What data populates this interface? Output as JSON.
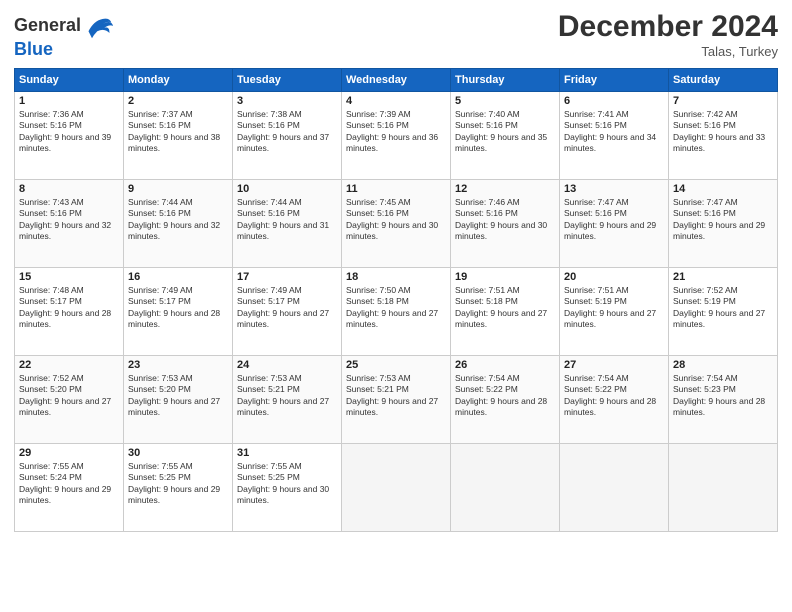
{
  "logo": {
    "text_general": "General",
    "text_blue": "Blue"
  },
  "header": {
    "month": "December 2024",
    "location": "Talas, Turkey"
  },
  "days_of_week": [
    "Sunday",
    "Monday",
    "Tuesday",
    "Wednesday",
    "Thursday",
    "Friday",
    "Saturday"
  ],
  "weeks": [
    [
      {
        "day": "1",
        "info": "Sunrise: 7:36 AM\nSunset: 5:16 PM\nDaylight: 9 hours and 39 minutes."
      },
      {
        "day": "2",
        "info": "Sunrise: 7:37 AM\nSunset: 5:16 PM\nDaylight: 9 hours and 38 minutes."
      },
      {
        "day": "3",
        "info": "Sunrise: 7:38 AM\nSunset: 5:16 PM\nDaylight: 9 hours and 37 minutes."
      },
      {
        "day": "4",
        "info": "Sunrise: 7:39 AM\nSunset: 5:16 PM\nDaylight: 9 hours and 36 minutes."
      },
      {
        "day": "5",
        "info": "Sunrise: 7:40 AM\nSunset: 5:16 PM\nDaylight: 9 hours and 35 minutes."
      },
      {
        "day": "6",
        "info": "Sunrise: 7:41 AM\nSunset: 5:16 PM\nDaylight: 9 hours and 34 minutes."
      },
      {
        "day": "7",
        "info": "Sunrise: 7:42 AM\nSunset: 5:16 PM\nDaylight: 9 hours and 33 minutes."
      }
    ],
    [
      {
        "day": "8",
        "info": "Sunrise: 7:43 AM\nSunset: 5:16 PM\nDaylight: 9 hours and 32 minutes."
      },
      {
        "day": "9",
        "info": "Sunrise: 7:44 AM\nSunset: 5:16 PM\nDaylight: 9 hours and 32 minutes."
      },
      {
        "day": "10",
        "info": "Sunrise: 7:44 AM\nSunset: 5:16 PM\nDaylight: 9 hours and 31 minutes."
      },
      {
        "day": "11",
        "info": "Sunrise: 7:45 AM\nSunset: 5:16 PM\nDaylight: 9 hours and 30 minutes."
      },
      {
        "day": "12",
        "info": "Sunrise: 7:46 AM\nSunset: 5:16 PM\nDaylight: 9 hours and 30 minutes."
      },
      {
        "day": "13",
        "info": "Sunrise: 7:47 AM\nSunset: 5:16 PM\nDaylight: 9 hours and 29 minutes."
      },
      {
        "day": "14",
        "info": "Sunrise: 7:47 AM\nSunset: 5:16 PM\nDaylight: 9 hours and 29 minutes."
      }
    ],
    [
      {
        "day": "15",
        "info": "Sunrise: 7:48 AM\nSunset: 5:17 PM\nDaylight: 9 hours and 28 minutes."
      },
      {
        "day": "16",
        "info": "Sunrise: 7:49 AM\nSunset: 5:17 PM\nDaylight: 9 hours and 28 minutes."
      },
      {
        "day": "17",
        "info": "Sunrise: 7:49 AM\nSunset: 5:17 PM\nDaylight: 9 hours and 27 minutes."
      },
      {
        "day": "18",
        "info": "Sunrise: 7:50 AM\nSunset: 5:18 PM\nDaylight: 9 hours and 27 minutes."
      },
      {
        "day": "19",
        "info": "Sunrise: 7:51 AM\nSunset: 5:18 PM\nDaylight: 9 hours and 27 minutes."
      },
      {
        "day": "20",
        "info": "Sunrise: 7:51 AM\nSunset: 5:19 PM\nDaylight: 9 hours and 27 minutes."
      },
      {
        "day": "21",
        "info": "Sunrise: 7:52 AM\nSunset: 5:19 PM\nDaylight: 9 hours and 27 minutes."
      }
    ],
    [
      {
        "day": "22",
        "info": "Sunrise: 7:52 AM\nSunset: 5:20 PM\nDaylight: 9 hours and 27 minutes."
      },
      {
        "day": "23",
        "info": "Sunrise: 7:53 AM\nSunset: 5:20 PM\nDaylight: 9 hours and 27 minutes."
      },
      {
        "day": "24",
        "info": "Sunrise: 7:53 AM\nSunset: 5:21 PM\nDaylight: 9 hours and 27 minutes."
      },
      {
        "day": "25",
        "info": "Sunrise: 7:53 AM\nSunset: 5:21 PM\nDaylight: 9 hours and 27 minutes."
      },
      {
        "day": "26",
        "info": "Sunrise: 7:54 AM\nSunset: 5:22 PM\nDaylight: 9 hours and 28 minutes."
      },
      {
        "day": "27",
        "info": "Sunrise: 7:54 AM\nSunset: 5:22 PM\nDaylight: 9 hours and 28 minutes."
      },
      {
        "day": "28",
        "info": "Sunrise: 7:54 AM\nSunset: 5:23 PM\nDaylight: 9 hours and 28 minutes."
      }
    ],
    [
      {
        "day": "29",
        "info": "Sunrise: 7:55 AM\nSunset: 5:24 PM\nDaylight: 9 hours and 29 minutes."
      },
      {
        "day": "30",
        "info": "Sunrise: 7:55 AM\nSunset: 5:25 PM\nDaylight: 9 hours and 29 minutes."
      },
      {
        "day": "31",
        "info": "Sunrise: 7:55 AM\nSunset: 5:25 PM\nDaylight: 9 hours and 30 minutes."
      },
      {
        "day": "",
        "info": ""
      },
      {
        "day": "",
        "info": ""
      },
      {
        "day": "",
        "info": ""
      },
      {
        "day": "",
        "info": ""
      }
    ]
  ]
}
